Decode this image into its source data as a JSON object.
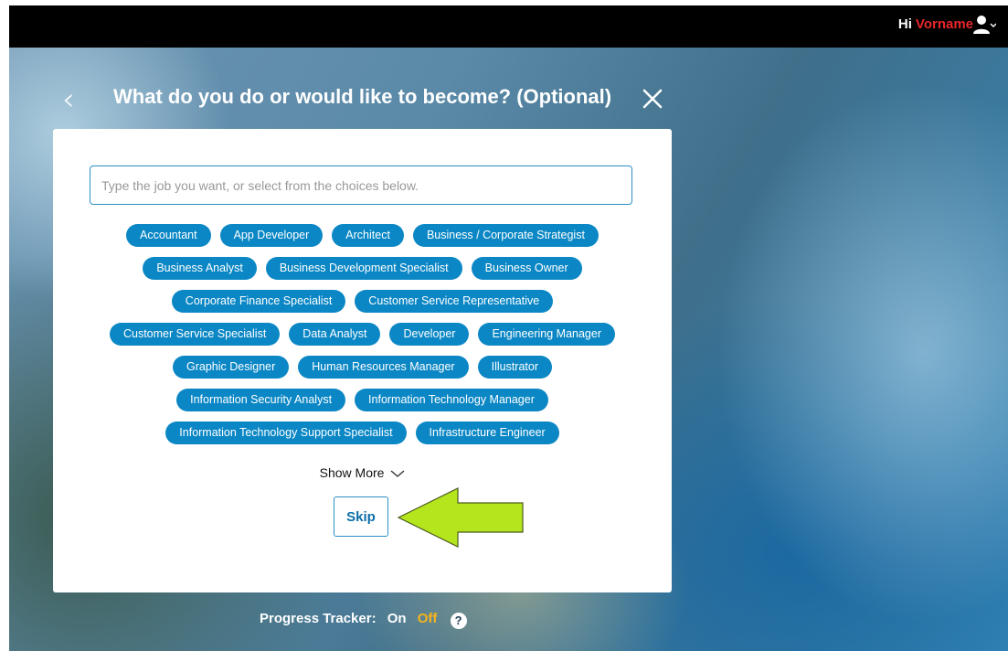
{
  "header": {
    "greeting": "Hi",
    "user_name": "Vorname"
  },
  "dialog": {
    "title": "What do you do or would like to become? (Optional)",
    "search_placeholder": "Type the job you want, or select from the choices below.",
    "job_rows": [
      [
        "Accountant",
        "App Developer",
        "Architect",
        "Business / Corporate Strategist"
      ],
      [
        "Business Analyst",
        "Business Development Specialist",
        "Business Owner"
      ],
      [
        "Corporate Finance Specialist",
        "Customer Service Representative"
      ],
      [
        "Customer Service Specialist",
        "Data Analyst",
        "Developer",
        "Engineering Manager"
      ],
      [
        "Graphic Designer",
        "Human Resources Manager",
        "Illustrator"
      ],
      [
        "Information Security Analyst",
        "Information Technology Manager"
      ],
      [
        "Information Technology Support Specialist",
        "Infrastructure Engineer"
      ]
    ],
    "show_more_label": "Show More",
    "skip_label": "Skip"
  },
  "progress_tracker": {
    "label": "Progress Tracker:",
    "on_label": "On",
    "off_label": "Off",
    "selected": "Off",
    "help_symbol": "?"
  },
  "colors": {
    "chip": "#0b87c5",
    "accent_name": "#e8262b",
    "off_highlight": "#f6b51a",
    "annotation_arrow": "#b5e61d"
  },
  "icons": {
    "user": "user-icon",
    "back": "chevron-left-icon",
    "close": "close-icon",
    "show_more": "chevron-down-icon",
    "help": "help-icon",
    "annotation": "arrow-left-icon"
  }
}
